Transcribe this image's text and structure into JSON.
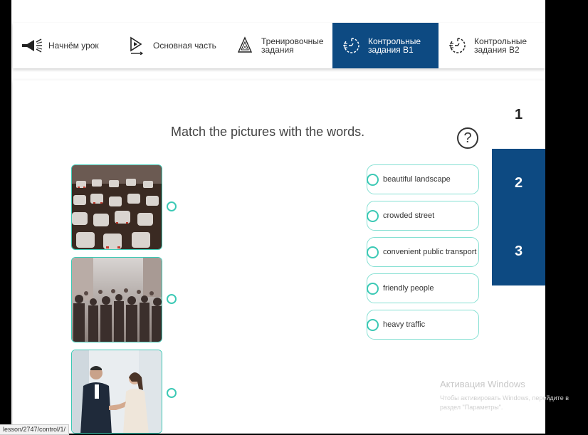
{
  "nav": {
    "items": [
      {
        "label_line1": "Начнём урок",
        "label_line2": "",
        "icon": "megaphone-icon",
        "active": false
      },
      {
        "label_line1": "Основная часть",
        "label_line2": "",
        "icon": "play-icon",
        "active": false
      },
      {
        "label_line1": "Тренировочные",
        "label_line2": "задания",
        "icon": "hourglass-icon",
        "active": false
      },
      {
        "label_line1": "Контрольные",
        "label_line2": "задания B1",
        "icon": "timer-icon",
        "active": true
      },
      {
        "label_line1": "Контрольные",
        "label_line2": "задания B2",
        "icon": "timer-icon",
        "active": false
      }
    ]
  },
  "task": {
    "title": "Match the pictures with the words.",
    "help_symbol": "?"
  },
  "pictures": [
    {
      "subject": "traffic-jam-image"
    },
    {
      "subject": "crowd-image"
    },
    {
      "subject": "handshake-image"
    }
  ],
  "words": [
    "beautiful landscape",
    "crowded street",
    "convenient public transport",
    "friendly people",
    "heavy traffic"
  ],
  "pages": [
    {
      "label": "1",
      "active": true
    },
    {
      "label": "2",
      "active": false
    },
    {
      "label": "3",
      "active": false
    }
  ],
  "watermark": {
    "title": "Активация Windows",
    "subtitle": "Чтобы активировать Windows, перейдите в раздел \"Параметры\"."
  },
  "status_url": "lesson/2747/control/1/",
  "colors": {
    "accent": "#0d4a82",
    "teal": "#3cc9b5"
  }
}
